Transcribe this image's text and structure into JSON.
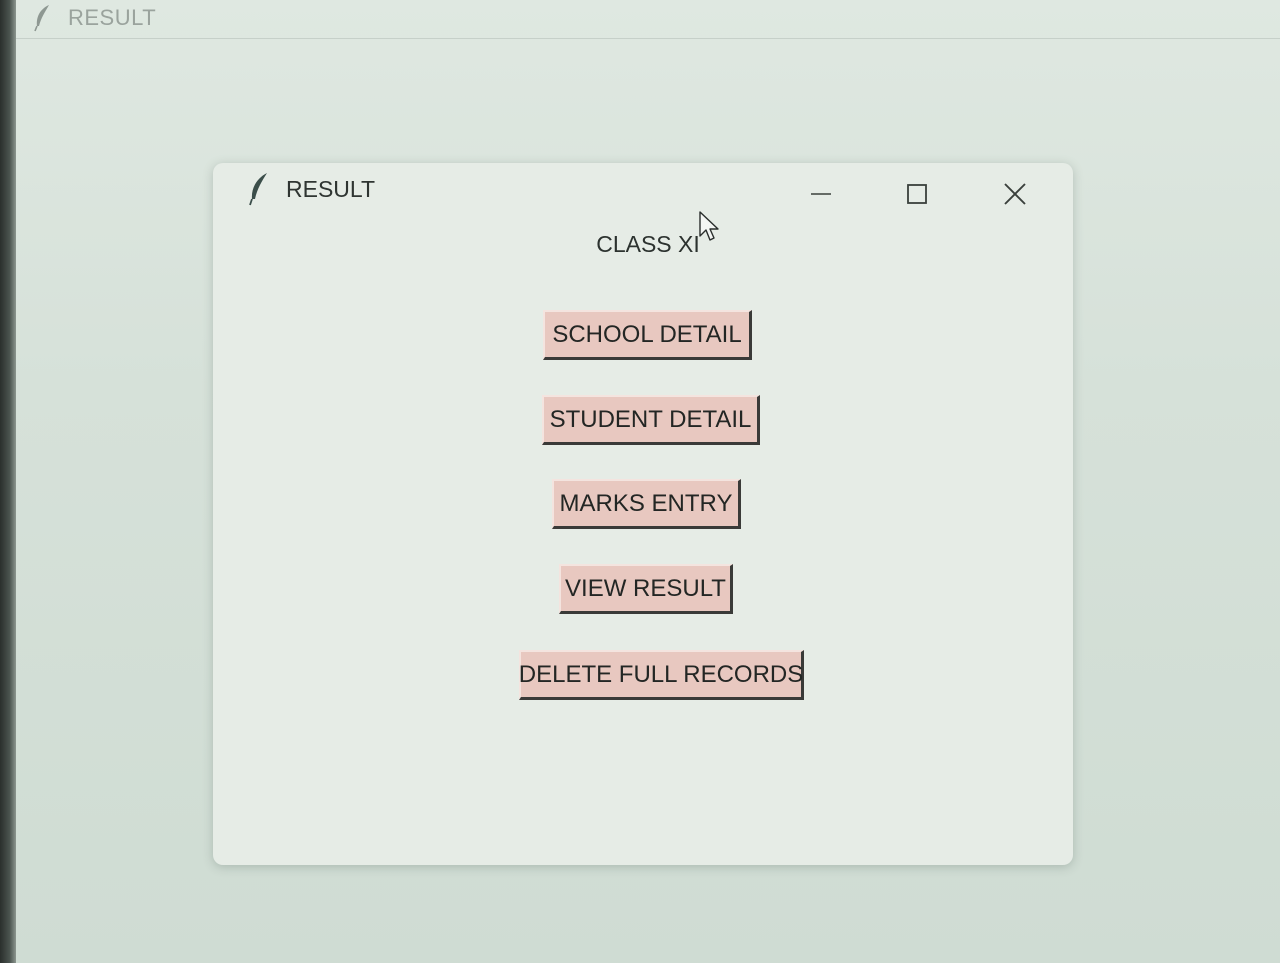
{
  "background_window": {
    "title": "RESULT",
    "icon": "feather-icon"
  },
  "dialog": {
    "title": "RESULT",
    "icon": "feather-icon",
    "controls": {
      "minimize_icon": "minimize-icon",
      "maximize_icon": "maximize-icon",
      "close_icon": "close-icon"
    },
    "heading": "CLASS XI",
    "buttons": [
      {
        "label": "SCHOOL DETAIL"
      },
      {
        "label": "STUDENT DETAIL"
      },
      {
        "label": "MARKS ENTRY"
      },
      {
        "label": "VIEW RESULT"
      },
      {
        "label": "DELETE FULL RECORDS"
      }
    ]
  },
  "colors": {
    "button_face": "#e8c8c0",
    "window_bg": "#e6ece6",
    "text": "#2c322f"
  }
}
